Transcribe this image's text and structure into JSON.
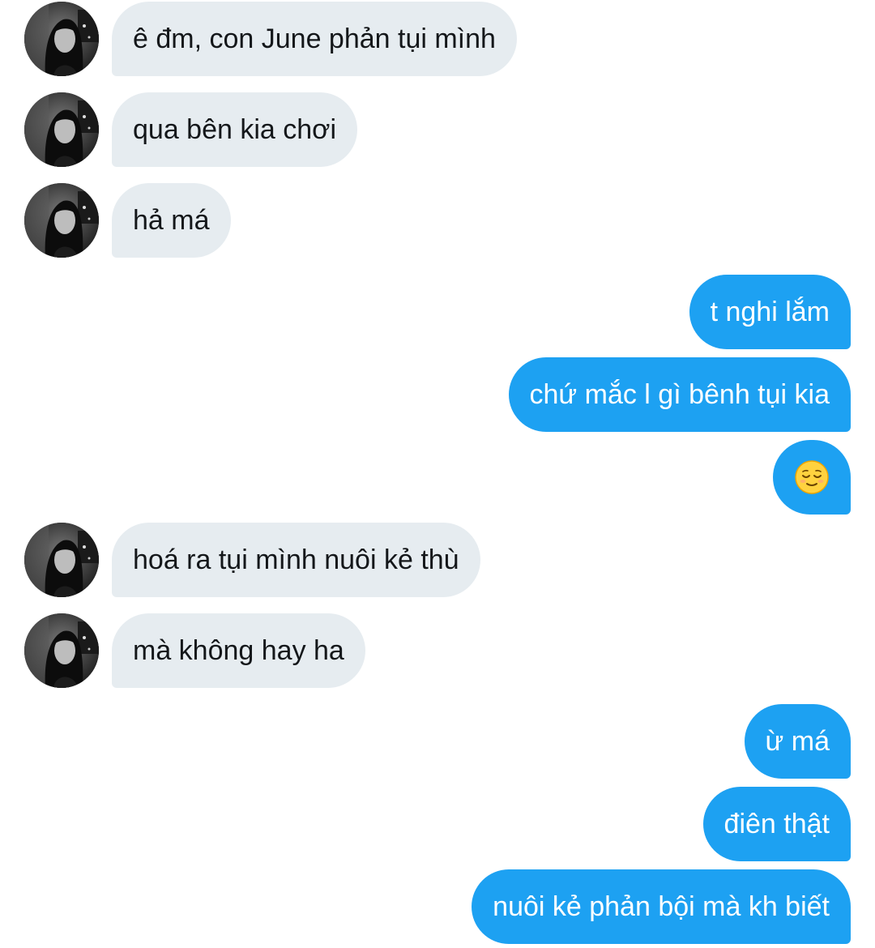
{
  "messages": [
    {
      "direction": "incoming",
      "text": "ê đm, con June phản tụi mình",
      "avatar_icon": "contact-avatar"
    },
    {
      "direction": "incoming",
      "text": "qua bên kia chơi",
      "avatar_icon": "contact-avatar"
    },
    {
      "direction": "incoming",
      "text": "hả má",
      "avatar_icon": "contact-avatar"
    },
    {
      "direction": "outgoing",
      "text": "t nghi lắm"
    },
    {
      "direction": "outgoing",
      "text": "chứ mắc l gì bênh tụi kia"
    },
    {
      "direction": "outgoing",
      "text": "",
      "emoji_icon": "relieved-face-emoji"
    },
    {
      "direction": "incoming",
      "text": "hoá ra tụi mình nuôi kẻ thù",
      "avatar_icon": "contact-avatar"
    },
    {
      "direction": "incoming",
      "text": "mà không hay ha",
      "avatar_icon": "contact-avatar"
    },
    {
      "direction": "outgoing",
      "text": "ừ má"
    },
    {
      "direction": "outgoing",
      "text": "điên thật"
    },
    {
      "direction": "outgoing",
      "text": "nuôi kẻ phản bội mà kh biết"
    }
  ],
  "colors": {
    "incoming_bubble": "#e6ecf0",
    "outgoing_bubble": "#1da1f2",
    "incoming_text": "#14171a",
    "outgoing_text": "#ffffff",
    "background": "#ffffff"
  }
}
